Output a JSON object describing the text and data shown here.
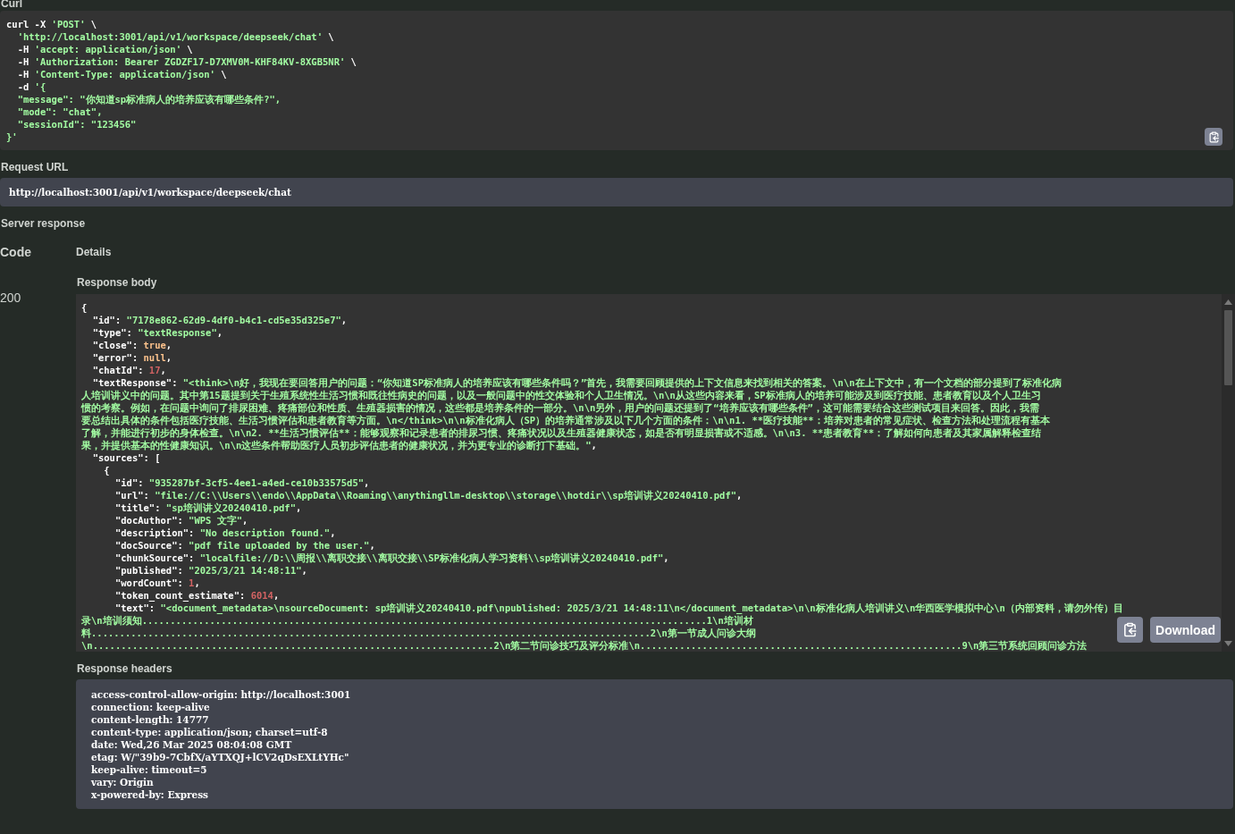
{
  "curl": {
    "label": "Curl",
    "lines": [
      [
        {
          "kind": "plain",
          "text": "curl -X "
        },
        {
          "kind": "string",
          "text": "'POST'"
        },
        {
          "kind": "plain",
          "text": " \\"
        }
      ],
      [
        {
          "kind": "string",
          "text": "  'http://localhost:3001/api/v1/workspace/deepseek/chat'"
        },
        {
          "kind": "plain",
          "text": " \\"
        }
      ],
      [
        {
          "kind": "plain",
          "text": "  -H "
        },
        {
          "kind": "string",
          "text": "'accept: application/json'"
        },
        {
          "kind": "plain",
          "text": " \\"
        }
      ],
      [
        {
          "kind": "plain",
          "text": "  -H "
        },
        {
          "kind": "string",
          "text": "'Authorization: Bearer ZGDZF17-D7XMV0M-KHF84KV-8XGB5NR'"
        },
        {
          "kind": "plain",
          "text": " \\"
        }
      ],
      [
        {
          "kind": "plain",
          "text": "  -H "
        },
        {
          "kind": "string",
          "text": "'Content-Type: application/json'"
        },
        {
          "kind": "plain",
          "text": " \\"
        }
      ],
      [
        {
          "kind": "plain",
          "text": "  -d "
        },
        {
          "kind": "string",
          "text": "'{"
        }
      ],
      [
        {
          "kind": "string",
          "text": "  \"message\": \"你知道sp标准病人的培养应该有哪些条件?\","
        }
      ],
      [
        {
          "kind": "string",
          "text": "  \"mode\": \"chat\","
        }
      ],
      [
        {
          "kind": "string",
          "text": "  \"sessionId\": \"123456\""
        }
      ],
      [
        {
          "kind": "string",
          "text": "}'"
        }
      ]
    ]
  },
  "request_url": {
    "label": "Request URL",
    "value": "http://localhost:3001/api/v1/workspace/deepseek/chat"
  },
  "server_response": {
    "label": "Server response",
    "columns": [
      "Code",
      "Details"
    ],
    "code": "200",
    "response_body": {
      "label": "Response body",
      "download_button": "Download",
      "lines": [
        [
          {
            "kind": "punct",
            "text": "{"
          }
        ],
        [
          {
            "kind": "punct",
            "text": "  \"id\": "
          },
          {
            "kind": "string",
            "text": "\"7178e862-62d9-4df0-b4c1-cd5e35d325e7\""
          },
          {
            "kind": "punct",
            "text": ","
          }
        ],
        [
          {
            "kind": "punct",
            "text": "  \"type\": "
          },
          {
            "kind": "string",
            "text": "\"textResponse\""
          },
          {
            "kind": "punct",
            "text": ","
          }
        ],
        [
          {
            "kind": "punct",
            "text": "  \"close\": "
          },
          {
            "kind": "literal",
            "text": "true"
          },
          {
            "kind": "punct",
            "text": ","
          }
        ],
        [
          {
            "kind": "punct",
            "text": "  \"error\": "
          },
          {
            "kind": "literal",
            "text": "null"
          },
          {
            "kind": "punct",
            "text": ","
          }
        ],
        [
          {
            "kind": "punct",
            "text": "  \"chatId\": "
          },
          {
            "kind": "number",
            "text": "17"
          },
          {
            "kind": "punct",
            "text": ","
          }
        ],
        [
          {
            "kind": "punct",
            "text": "  \"textResponse\": "
          },
          {
            "kind": "string",
            "text": "\"<think>\\n好，我现在要回答用户的问题：“你知道SP标准病人的培养应该有哪些条件吗？”首先，我需要回顾提供的上下文信息来找到相关的答案。\\n\\n在上下文中，有一个文档的部分提到了标准化病"
          }
        ],
        [
          {
            "kind": "string",
            "text": "人培训讲义中的问题。其中第15题提到关于生殖系统性生活习惯和既往性病史的问题，以及一般问题中的性交体验和个人卫生情况。\\n\\n从这些内容来看，SP标准病人的培养可能涉及到医疗技能、患者教育以及个人卫生习"
          }
        ],
        [
          {
            "kind": "string",
            "text": "惯的考察。例如，在问题中询问了排尿困难、疼痛部位和性质、生殖器损害的情况，这些都是培养条件的一部分。\\n\\n另外，用户的问题还提到了“培养应该有哪些条件”，这可能需要结合这些测试项目来回答。因此，我需"
          }
        ],
        [
          {
            "kind": "string",
            "text": "要总结出具体的条件包括医疗技能、生活习惯评估和患者教育等方面。\\n</think>\\n\\n标准化病人（SP）的培养通常涉及以下几个方面的条件：\\n\\n1. **医疗技能**：培养对患者的常见症状、检查方法和处理流程有基本"
          }
        ],
        [
          {
            "kind": "string",
            "text": "了解，并能进行初步的身体检查。\\n\\n2. **生活习惯评估**：能够观察和记录患者的排尿习惯、疼痛状况以及生殖器健康状态，如是否有明显损害或不适感。\\n\\n3. **患者教育**：了解如何向患者及其家属解释检查结"
          }
        ],
        [
          {
            "kind": "string",
            "text": "果，并提供基本的性健康知识。\\n\\n这些条件帮助医疗人员初步评估患者的健康状况，并为更专业的诊断打下基础。\""
          },
          {
            "kind": "punct",
            "text": ","
          }
        ],
        [
          {
            "kind": "punct",
            "text": "  \"sources\": ["
          }
        ],
        [
          {
            "kind": "punct",
            "text": "    {"
          }
        ],
        [
          {
            "kind": "punct",
            "text": "      \"id\": "
          },
          {
            "kind": "string",
            "text": "\"935287bf-3cf5-4ee1-a4ed-ce10b33575d5\""
          },
          {
            "kind": "punct",
            "text": ","
          }
        ],
        [
          {
            "kind": "punct",
            "text": "      \"url\": "
          },
          {
            "kind": "string",
            "text": "\"file://C:\\\\Users\\\\endo\\\\AppData\\\\Roaming\\\\anythingllm-desktop\\\\storage\\\\hotdir\\\\sp培训讲义20240410.pdf\""
          },
          {
            "kind": "punct",
            "text": ","
          }
        ],
        [
          {
            "kind": "punct",
            "text": "      \"title\": "
          },
          {
            "kind": "string",
            "text": "\"sp培训讲义20240410.pdf\""
          },
          {
            "kind": "punct",
            "text": ","
          }
        ],
        [
          {
            "kind": "punct",
            "text": "      \"docAuthor\": "
          },
          {
            "kind": "string",
            "text": "\"WPS 文字\""
          },
          {
            "kind": "punct",
            "text": ","
          }
        ],
        [
          {
            "kind": "punct",
            "text": "      \"description\": "
          },
          {
            "kind": "string",
            "text": "\"No description found.\""
          },
          {
            "kind": "punct",
            "text": ","
          }
        ],
        [
          {
            "kind": "punct",
            "text": "      \"docSource\": "
          },
          {
            "kind": "string",
            "text": "\"pdf file uploaded by the user.\""
          },
          {
            "kind": "punct",
            "text": ","
          }
        ],
        [
          {
            "kind": "punct",
            "text": "      \"chunkSource\": "
          },
          {
            "kind": "string",
            "text": "\"localfile://D:\\\\周报\\\\离职交接\\\\离职交接\\\\SP标准化病人学习资料\\\\sp培训讲义20240410.pdf\""
          },
          {
            "kind": "punct",
            "text": ","
          }
        ],
        [
          {
            "kind": "punct",
            "text": "      \"published\": "
          },
          {
            "kind": "string",
            "text": "\"2025/3/21 14:48:11\""
          },
          {
            "kind": "punct",
            "text": ","
          }
        ],
        [
          {
            "kind": "punct",
            "text": "      \"wordCount\": "
          },
          {
            "kind": "number",
            "text": "1"
          },
          {
            "kind": "punct",
            "text": ","
          }
        ],
        [
          {
            "kind": "punct",
            "text": "      \"token_count_estimate\": "
          },
          {
            "kind": "number",
            "text": "6014"
          },
          {
            "kind": "punct",
            "text": ","
          }
        ],
        [
          {
            "kind": "punct",
            "text": "      \"text\": "
          },
          {
            "kind": "string",
            "text": "\"<document_metadata>\\nsourceDocument: sp培训讲义20240410.pdf\\npublished: 2025/3/21 14:48:11\\n</document_metadata>\\n\\n标准化病人培训讲义\\n华西医学模拟中心\\n（内部资料，请勿外传）目"
          }
        ],
        [
          {
            "kind": "string",
            "text": "录\\n培训须知....................................................................................................1\\n培训材"
          }
        ],
        [
          {
            "kind": "string",
            "text": "料...................................................................................................2\\n第一节成人问诊大纲"
          }
        ],
        [
          {
            "kind": "string",
            "text": "\\n.......................................................................2\\n第二节问诊技巧及评分标准\\n.........................................................9\\n第三节系统回顾问诊方法"
          }
        ]
      ]
    },
    "response_headers": {
      "label": "Response headers",
      "lines": [
        "access-control-allow-origin: http://localhost:3001",
        "connection: keep-alive",
        "content-length: 14777",
        "content-type: application/json; charset=utf-8",
        "date: Wed,26 Mar 2025 08:04:08 GMT",
        "etag: W/\"39b9-7CbfX/aYTXQJ+lCV2qDsEXLtYHc\"",
        "keep-alive: timeout=5",
        "vary: Origin",
        "x-powered-by: Express"
      ]
    }
  }
}
